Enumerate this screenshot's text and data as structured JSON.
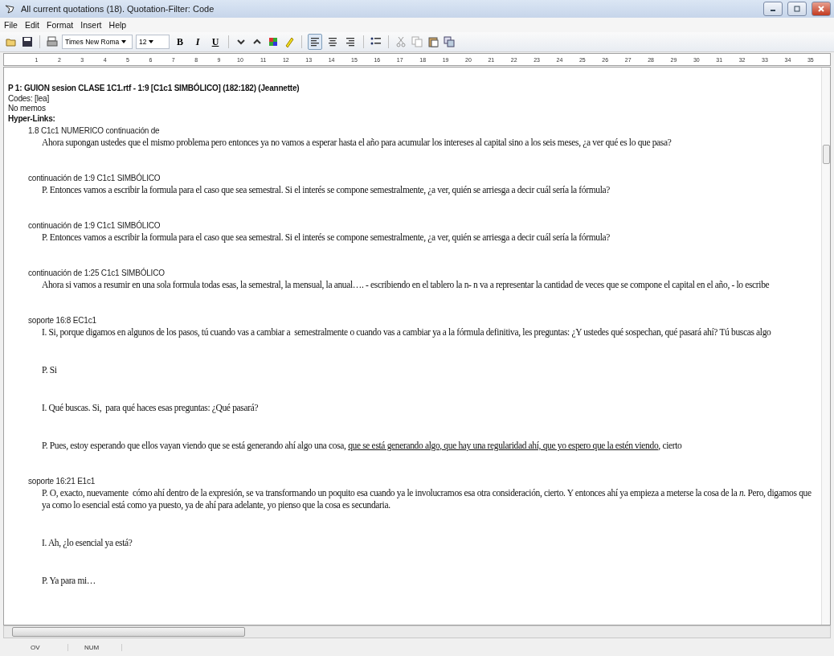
{
  "window": {
    "title": "All current quotations (18). Quotation-Filter: Code"
  },
  "menu": [
    "File",
    "Edit",
    "Format",
    "Insert",
    "Help"
  ],
  "toolbar": {
    "font": "Times New Roma",
    "size": "12",
    "format_buttons": [
      "B",
      "I",
      "U"
    ],
    "alignment": [
      {
        "selected": true
      },
      {
        "selected": false
      },
      {
        "selected": false
      }
    ]
  },
  "ruler": [
    "1",
    "2",
    "3",
    "4",
    "5",
    "6",
    "7",
    "8",
    "9",
    "10",
    "11",
    "12",
    "13",
    "14",
    "15",
    "16",
    "17",
    "18",
    "19",
    "20",
    "21",
    "22",
    "23",
    "24",
    "25",
    "26",
    "27",
    "28",
    "29",
    "30",
    "31",
    "32",
    "33",
    "34",
    "35"
  ],
  "document": {
    "title": "P 1: GUION sesion CLASE 1C1.rtf - 1:9 [C1c1 SIMBÓLICO]  (182:182)   (Jeannette)",
    "codes": "Codes:  [lea]",
    "memos": "No memos",
    "links_heading": "Hyper-Links:",
    "links": [
      {
        "label": "1.8 C1c1 NUMERICO continuación de",
        "paragraphs": [
          [
            {
              "text": "Ahora supongan ustedes que el mismo problema pero entonces ya no vamos a esperar hasta el año para acumular los intereses al capital sino a los seis meses, ¿a ver qué es lo que pasa?",
              "underlined": false
            }
          ]
        ]
      },
      {
        "label": "continuación de 1:9 C1c1 SIMBÓLICO",
        "paragraphs": [
          [
            {
              "text": "P. Entonces vamos a escribir la formula para el caso que sea semestral. Si el interés se compone semestralmente, ¿a ver, quién se arriesga a decir cuál sería la fórmula?",
              "underlined": false
            }
          ]
        ]
      },
      {
        "label": "continuación de 1:9 C1c1 SIMBÓLICO",
        "paragraphs": [
          [
            {
              "text": "P. Entonces vamos a escribir la formula para el caso que sea semestral. Si el interés se compone semestralmente, ¿a ver, quién se arriesga a decir cuál sería la fórmula?",
              "underlined": false
            }
          ]
        ]
      },
      {
        "label": "continuación de 1:25 C1c1 SIMBÓLICO",
        "paragraphs": [
          [
            {
              "text": "Ahora si vamos a resumir en una sola formula todas esas, la semestral, la mensual, la anual…. - escribiendo en el tablero la n- n va a representar la cantidad de veces que se compone el capital en el año, - lo escribe",
              "underlined": false
            }
          ]
        ]
      },
      {
        "label": "soporte 16:8 EC1c1",
        "paragraphs": [
          [
            {
              "text": "I. Si, porque digamos en algunos de los pasos, tú cuando vas a cambiar a  semestralmente o cuando vas a cambiar ya a la fórmula definitiva, les preguntas: ¿Y ustedes qué sospechan, qué pasará ahí? Tú buscas algo",
              "underlined": false
            }
          ],
          [
            {
              "text": "P. Si",
              "underlined": false
            }
          ],
          [
            {
              "text": "I. Qué buscas. Si,  para qué haces esas preguntas: ¿Qué pasará?",
              "underlined": false
            }
          ],
          [
            {
              "text": "P. Pues, estoy esperando que ellos vayan viendo que se está generando ahí algo una cosa, ",
              "underlined": false
            },
            {
              "text": "que se está generando algo, que hay una regularidad ahí, que yo espero que la estén viendo",
              "underlined": true
            },
            {
              "text": ", cierto",
              "underlined": false
            }
          ]
        ]
      },
      {
        "label": "soporte 16:21 E1c1",
        "paragraphs": [
          [
            {
              "text": "P. O, exacto, nuevamente  cómo ahí dentro de la expresión, se va transformando un poquito esa cuando ya le involucramos esa otra consideración, cierto. Y entonces ahí ya empieza a meterse la cosa de la *n*. Pero, digamos que ya como lo esencial está como ya puesto, ya de ahí para adelante, yo pienso que la cosa es secundaria.",
              "underlined": false
            }
          ],
          [
            {
              "text": "I. Ah, ¿lo esencial ya está?",
              "underlined": false
            }
          ],
          [
            {
              "text": "P. Ya para mi…",
              "underlined": false
            }
          ]
        ]
      }
    ]
  },
  "status_bar": [
    "OV",
    "NUM"
  ]
}
